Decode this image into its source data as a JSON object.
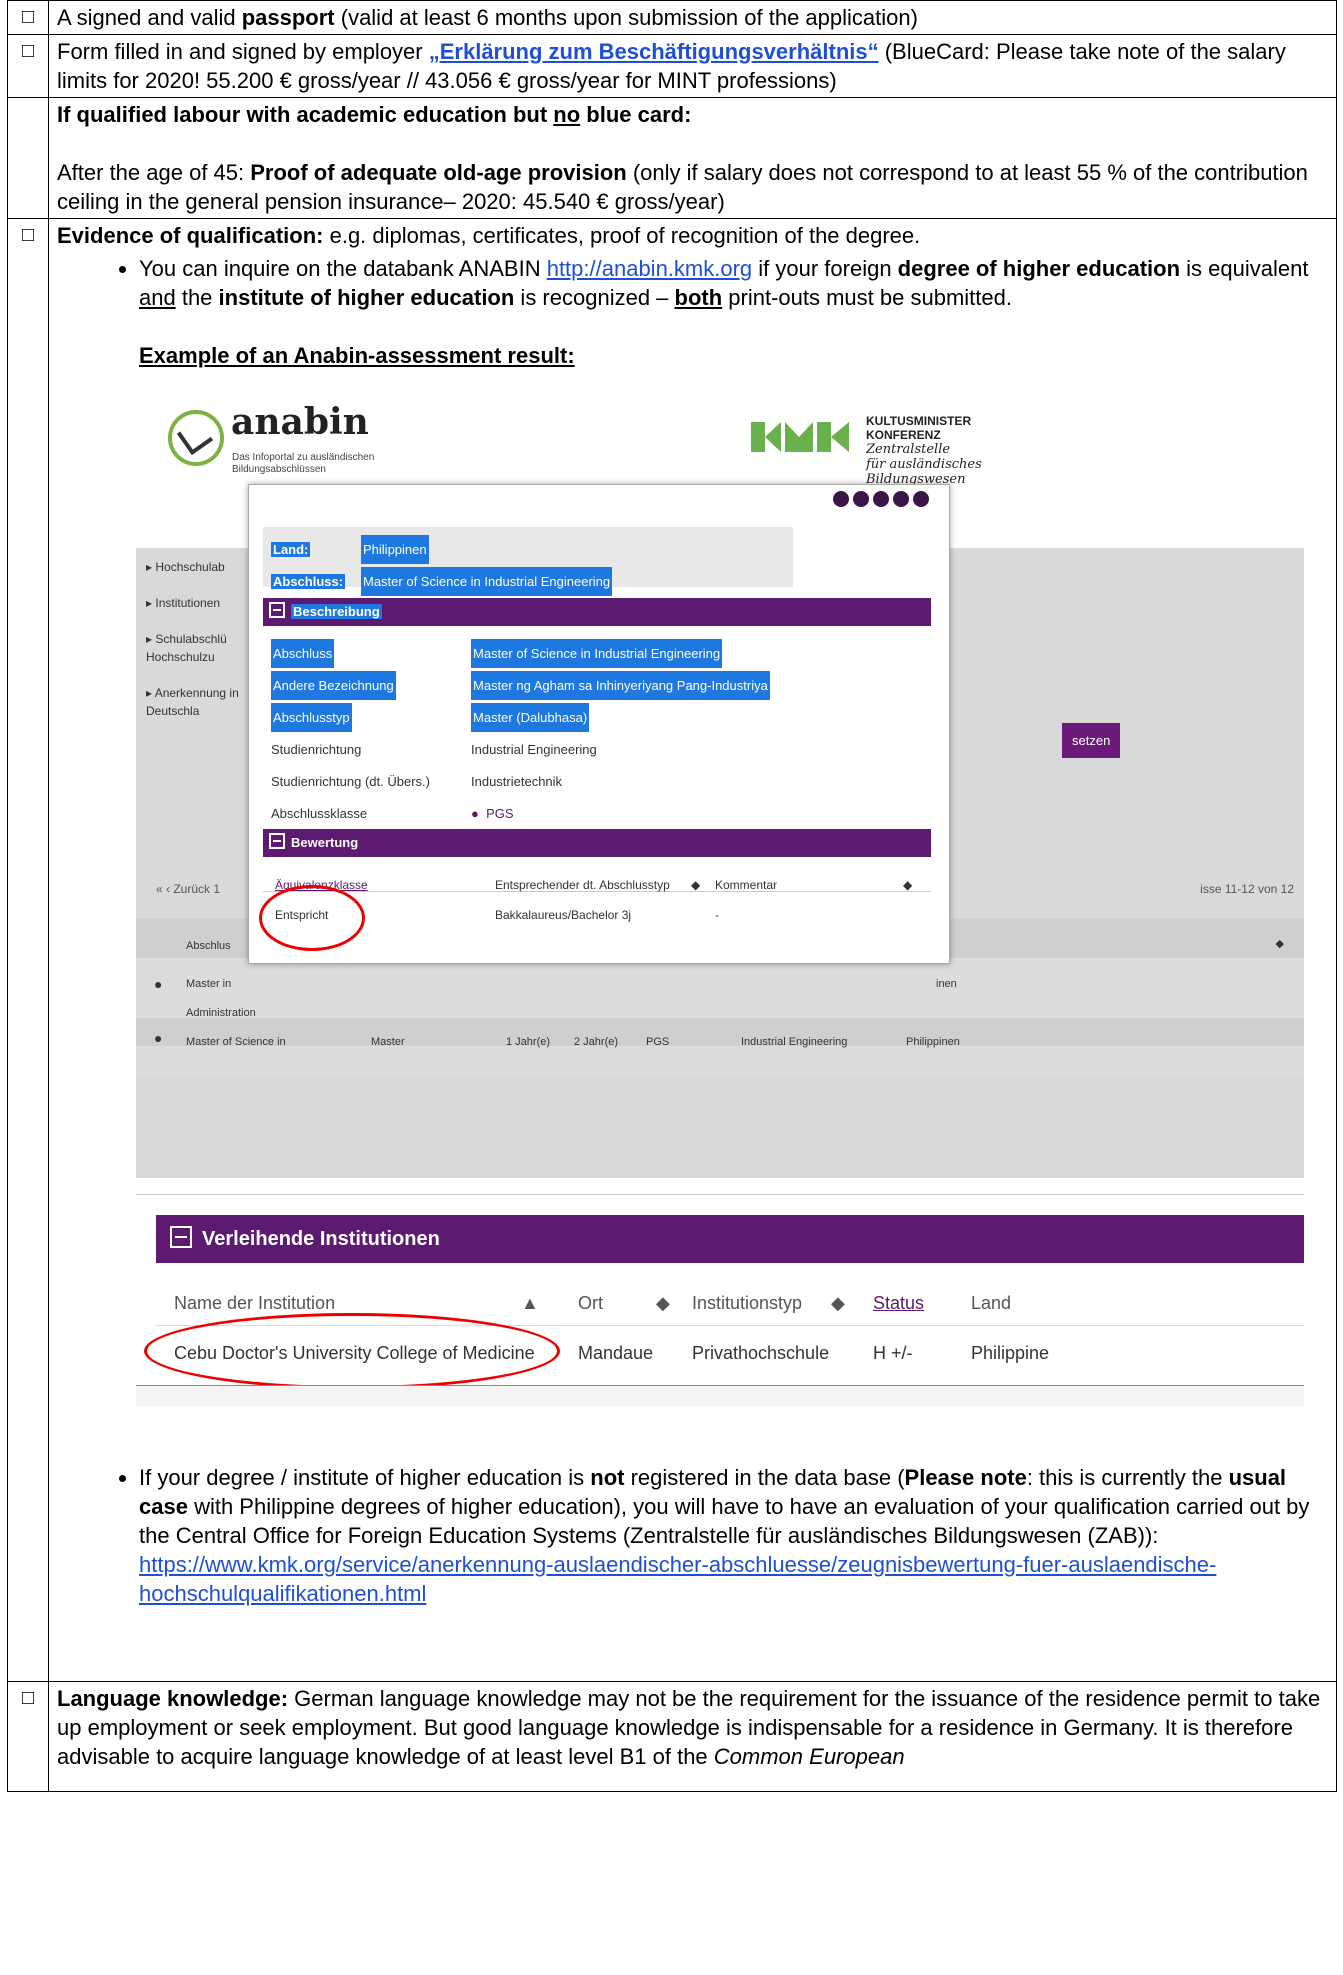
{
  "checkbox": "□",
  "row1": {
    "text_a": "A signed and valid ",
    "bold": "passport",
    "text_b": " (valid at least 6 months upon submission of the application)"
  },
  "row2": {
    "text_a": "Form filled in and signed by employer ",
    "link": "„Erklärung zum Beschäftigungsverhältnis“",
    "text_b": " (BlueCard: Please take note of the salary limits for 2020! 55.200 € gross/year // 43.056 € gross/year for MINT professions)"
  },
  "row3": {
    "head_a": "If qualified labour with academic education but ",
    "head_u": "no",
    "head_b": " blue card:",
    "line_a": "After the age of 45: ",
    "line_bold": "Proof of adequate old-age provision",
    "line_b": " (only if salary does not correspond to at least 55 % of the  contribution ceiling in the general pension insurance– 2020: 45.540 € gross/year)"
  },
  "row4": {
    "head_bold": "Evidence of qualification:",
    "head_rest": " e.g. diplomas, certificates, proof of recognition of the degree.",
    "b1_a": "You can inquire on the databank ANABIN ",
    "b1_link": "http://anabin.kmk.org",
    "b1_b": "  if your foreign ",
    "b1_bold1": "degree of higher education",
    "b1_c": " is equivalent ",
    "b1_u": "and",
    "b1_d": " the ",
    "b1_bold2": "institute of higher education",
    "b1_e": " is recognized – ",
    "b1_bu": "both",
    "b1_f": " print-outs must be submitted.",
    "example": "Example of an Anabin-assessment result:",
    "b2_a": "If your degree / institute of higher education is ",
    "b2_bold1": "not",
    "b2_b": " registered in the data base (",
    "b2_bold2": "Please note",
    "b2_c": ": this is currently the ",
    "b2_bold3": "usual case",
    "b2_d": " with Philippine degrees of higher education), you will have to have an evaluation of your qualification carried out by the Central Office for Foreign Education Systems (Zentralstelle für ausländisches Bildungswesen (ZAB)):",
    "b2_link": "https://www.kmk.org/service/anerkennung-auslaendischer-abschluesse/zeugnisbewertung-fuer-auslaendische-hochschulqualifikationen.html"
  },
  "row5": {
    "head_bold": "Language knowledge:",
    "text": " German language knowledge may not be the requirement for the issuance of the residence permit to take up employment or seek employment. But good language knowledge is indispensable for a residence in Germany. It is therefore advisable to acquire language knowledge of at least level B1 of the ",
    "italic": "Common European"
  },
  "anabin": {
    "brand": "anabin",
    "subtitle": "Das Infoportal zu ausländischen Bildungsabschlüssen",
    "kmk_line1": "KULTUSMINISTER",
    "kmk_line2": "KONFERENZ",
    "kmk_line3": "Zentralstelle",
    "kmk_line4": "für ausländisches",
    "kmk_line5": "Bildungswesen",
    "nav": [
      "Hochschulab",
      "Institutionen",
      "Schulabschlü Hochschulzu",
      "Anerkennung in Deutschla"
    ],
    "setzen": "setzen",
    "pagination": "« ‹ Zurück  1",
    "results": "isse 11-12 von 12",
    "bg_rows": [
      {
        "c1": "Abschlus",
        "c2": ""
      },
      {
        "c1": "Master in Administration",
        "c2": "inen"
      },
      {
        "c1": "Master of Science in",
        "c2": "Master",
        "c3": "1 Jahr(e)",
        "c4": "2 Jahr(e)",
        "c5": "PGS",
        "c6": "Industrial Engineering",
        "c7": "Philippinen"
      }
    ],
    "modal": {
      "land_label": "Land:",
      "land_value": "Philippinen",
      "abschluss_label": "Abschluss:",
      "abschluss_value": "Master of Science in Industrial Engineering",
      "beschreibung": "Beschreibung",
      "rows": [
        {
          "k": "Abschluss",
          "v": "Master of Science in Industrial Engineering"
        },
        {
          "k": "Andere Bezeichnung",
          "v": "Master ng Agham sa Inhinyeriyang Pang-Industriya"
        },
        {
          "k": "Abschlusstyp",
          "v": "Master (Dalubhasa)"
        },
        {
          "k": "Studienrichtung",
          "v": "Industrial Engineering"
        },
        {
          "k": "Studienrichtung (dt. Übers.)",
          "v": "Industrietechnik"
        },
        {
          "k": "Abschlussklasse",
          "v": "PGS"
        }
      ],
      "bewertung": "Bewertung",
      "bew_h1": "Äquivalenzklasse",
      "bew_h2": "Entsprechender dt. Abschlusstyp",
      "bew_h3": "Kommentar",
      "bew_v1": "Entspricht",
      "bew_v2": "Bakkalaureus/Bachelor 3j",
      "bew_v3": "-"
    },
    "inst": {
      "title": "Verleihende Institutionen",
      "h1": "Name der Institution",
      "h2": "Ort",
      "h3": "Institutionstyp",
      "h4": "Status",
      "h5": "Land",
      "v1": "Cebu Doctor's University College of Medicine",
      "v2": "Mandaue",
      "v3": "Privathochschule",
      "v4": "H +/-",
      "v5": "Philippine"
    }
  }
}
